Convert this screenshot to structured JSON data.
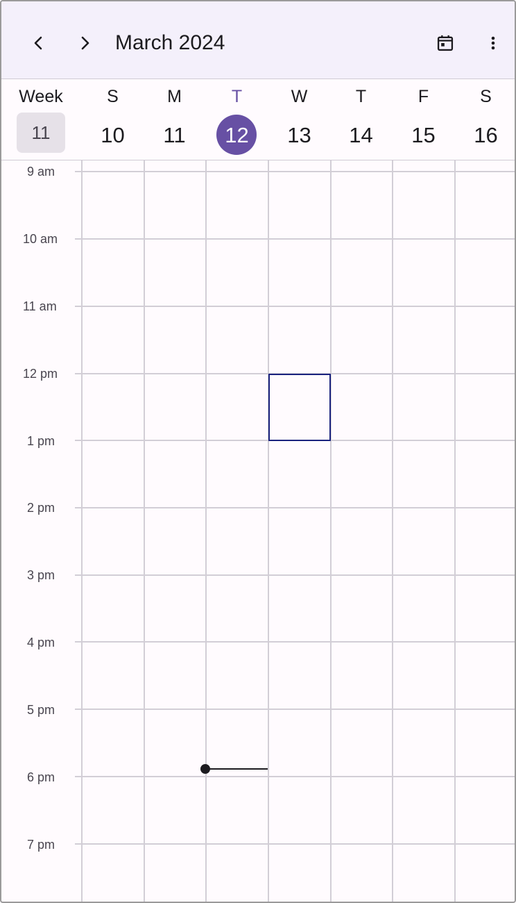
{
  "header": {
    "title": "March 2024",
    "prev_icon": "chevron-left-icon",
    "next_icon": "chevron-right-icon",
    "today_icon": "calendar-today-icon",
    "menu_icon": "more-vertical-icon"
  },
  "week": {
    "label": "Week",
    "number": "11"
  },
  "days": [
    {
      "letter": "S",
      "number": "10"
    },
    {
      "letter": "M",
      "number": "11"
    },
    {
      "letter": "T",
      "number": "12",
      "today": true
    },
    {
      "letter": "W",
      "number": "13"
    },
    {
      "letter": "T",
      "number": "14"
    },
    {
      "letter": "F",
      "number": "15"
    },
    {
      "letter": "S",
      "number": "16"
    }
  ],
  "hours": [
    "9 am",
    "10 am",
    "11 am",
    "12 pm",
    "1 pm",
    "2 pm",
    "3 pm",
    "4 pm",
    "5 pm",
    "6 pm",
    "7 pm"
  ],
  "colors": {
    "accent": "#6750a4",
    "selection": "#1a237e",
    "appbar": "#f4f0fb"
  }
}
